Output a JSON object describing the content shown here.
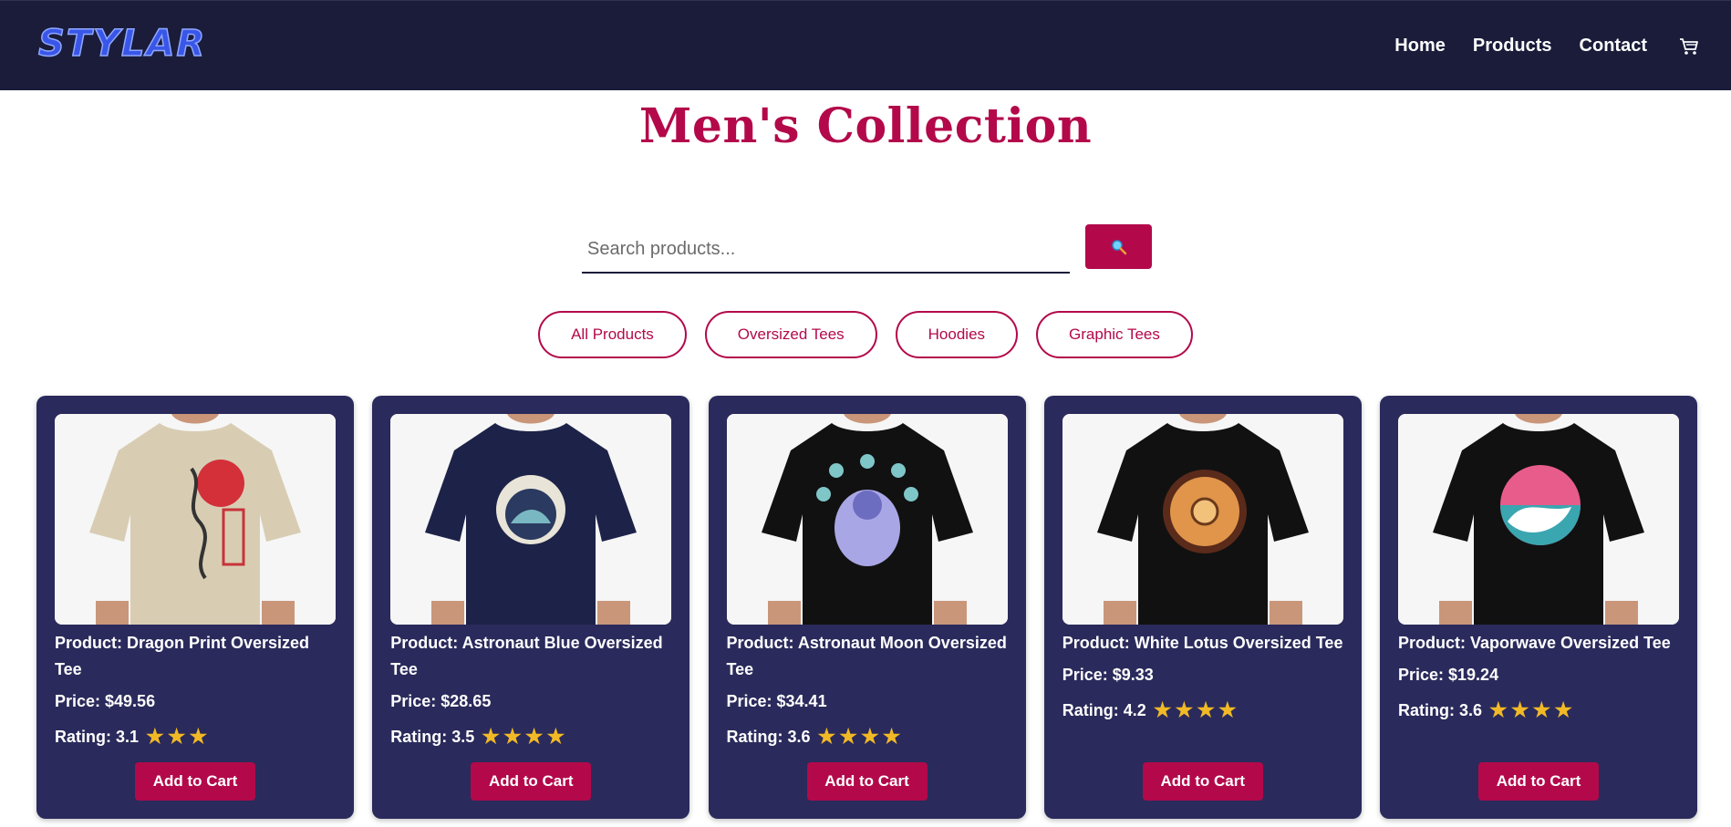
{
  "brand": {
    "logo_text": "STYLAR"
  },
  "nav": {
    "items": [
      {
        "label": "Home"
      },
      {
        "label": "Products"
      },
      {
        "label": "Contact"
      }
    ],
    "cart_icon": "cart-icon"
  },
  "page": {
    "title": "Men's Collection"
  },
  "search": {
    "placeholder": "Search products...",
    "value": "",
    "button_icon": "search-icon"
  },
  "filters": [
    {
      "label": "All Products"
    },
    {
      "label": "Oversized Tees"
    },
    {
      "label": "Hoodies"
    },
    {
      "label": "Graphic Tees"
    }
  ],
  "products": [
    {
      "title": "Product: Dragon Print Oversized Tee",
      "price": "Price: $49.56",
      "rating": "Rating: 3.1",
      "stars": 3,
      "button": "Add to Cart",
      "shirt_color": "#d8cdb3"
    },
    {
      "title": "Product: Astronaut Blue Oversized Tee",
      "price": "Price: $28.65",
      "rating": "Rating: 3.5",
      "stars": 4,
      "button": "Add to Cart",
      "shirt_color": "#1d2248"
    },
    {
      "title": "Product: Astronaut Moon Oversized Tee",
      "price": "Price: $34.41",
      "rating": "Rating: 3.6",
      "stars": 4,
      "button": "Add to Cart",
      "shirt_color": "#111111"
    },
    {
      "title": "Product: White Lotus Oversized Tee",
      "price": "Price: $9.33",
      "rating": "Rating: 4.2",
      "stars": 4,
      "button": "Add to Cart",
      "shirt_color": "#111111"
    },
    {
      "title": "Product: Vaporwave Oversized Tee",
      "price": "Price: $19.24",
      "rating": "Rating: 3.6",
      "stars": 4,
      "button": "Add to Cart",
      "shirt_color": "#111111"
    }
  ],
  "colors": {
    "navbar": "#1a1c3a",
    "accent": "#b3094a",
    "card": "#2a2a5c",
    "star": "#f1b925"
  }
}
